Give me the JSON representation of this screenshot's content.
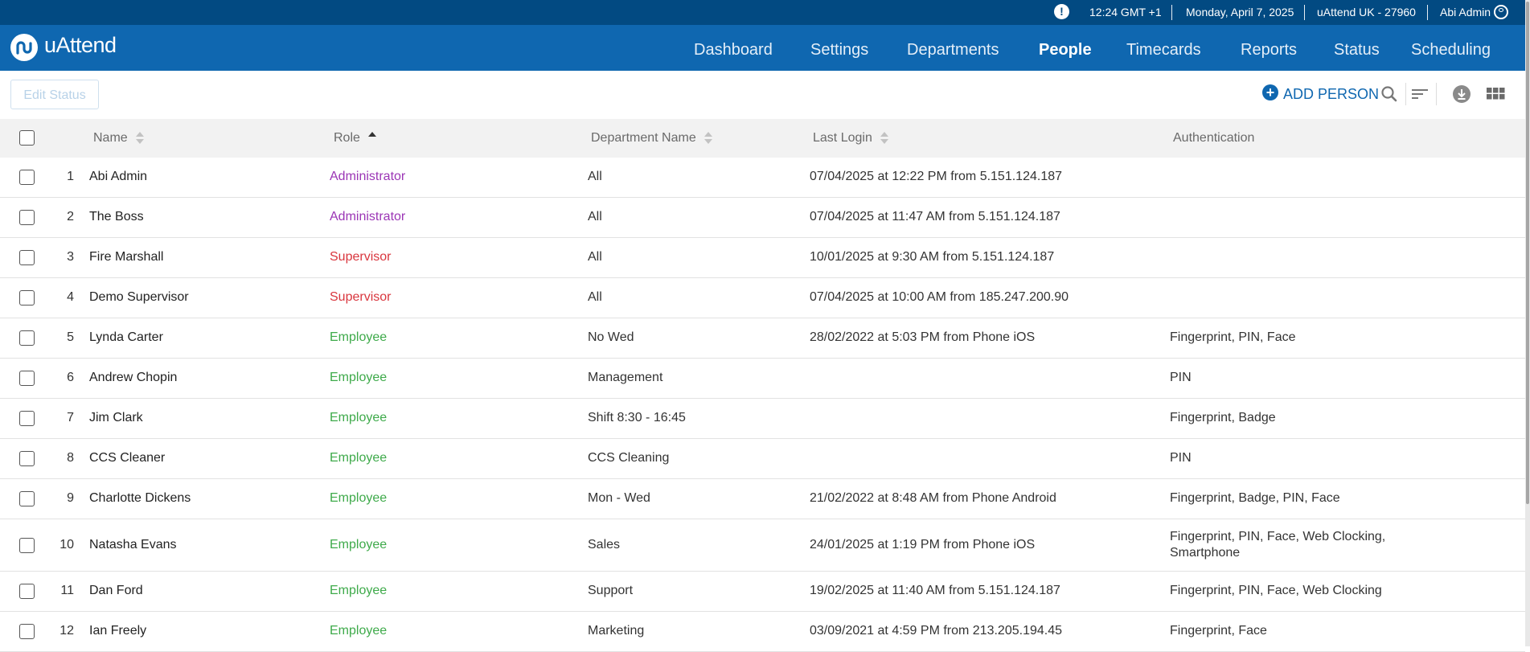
{
  "topbar": {
    "time": "12:24 GMT +1",
    "date": "Monday, April 7, 2025",
    "account": "uAttend UK - 27960",
    "user": "Abi Admin"
  },
  "brand": {
    "logo_text": "uAttend"
  },
  "nav": [
    {
      "label": "Dashboard"
    },
    {
      "label": "Settings"
    },
    {
      "label": "Departments"
    },
    {
      "label": "People",
      "active": true
    },
    {
      "label": "Timecards"
    },
    {
      "label": "Reports"
    },
    {
      "label": "Status"
    },
    {
      "label": "Scheduling"
    }
  ],
  "toolbar": {
    "edit_status": "Edit Status",
    "add_person": "ADD PERSON",
    "icons": [
      "search-icon",
      "sort-lines-icon",
      "download-icon",
      "grid-view-icon"
    ]
  },
  "table": {
    "columns": {
      "name": "Name",
      "role": "Role",
      "department": "Department Name",
      "last_login": "Last Login",
      "authentication": "Authentication"
    },
    "rows": [
      {
        "num": "1",
        "name": "Abi Admin",
        "role": "Administrator",
        "dept": "All",
        "login": "07/04/2025 at 12:22 PM from 5.151.124.187",
        "auth": ""
      },
      {
        "num": "2",
        "name": "The Boss",
        "role": "Administrator",
        "dept": "All",
        "login": "07/04/2025 at 11:47 AM from 5.151.124.187",
        "auth": ""
      },
      {
        "num": "3",
        "name": "Fire Marshall",
        "role": "Supervisor",
        "dept": "All",
        "login": "10/01/2025 at 9:30 AM from 5.151.124.187",
        "auth": ""
      },
      {
        "num": "4",
        "name": "Demo Supervisor",
        "role": "Supervisor",
        "dept": "All",
        "login": "07/04/2025 at 10:00 AM from 185.247.200.90",
        "auth": ""
      },
      {
        "num": "5",
        "name": "Lynda Carter",
        "role": "Employee",
        "dept": "No Wed",
        "login": "28/02/2022 at 5:03 PM from Phone iOS",
        "auth": "Fingerprint, PIN, Face"
      },
      {
        "num": "6",
        "name": "Andrew Chopin",
        "role": "Employee",
        "dept": "Management",
        "login": "",
        "auth": "PIN"
      },
      {
        "num": "7",
        "name": "Jim Clark",
        "role": "Employee",
        "dept": "Shift 8:30 - 16:45",
        "login": "",
        "auth": "Fingerprint, Badge"
      },
      {
        "num": "8",
        "name": "CCS Cleaner",
        "role": "Employee",
        "dept": "CCS Cleaning",
        "login": "",
        "auth": "PIN"
      },
      {
        "num": "9",
        "name": "Charlotte Dickens",
        "role": "Employee",
        "dept": "Mon - Wed",
        "login": "21/02/2022 at 8:48 AM from Phone Android",
        "auth": "Fingerprint, Badge, PIN, Face"
      },
      {
        "num": "10",
        "name": "Natasha Evans",
        "role": "Employee",
        "dept": "Sales",
        "login": "24/01/2025 at 1:19 PM from Phone iOS",
        "auth": "Fingerprint, PIN, Face, Web Clocking,",
        "auth2": "Smartphone"
      },
      {
        "num": "11",
        "name": "Dan Ford",
        "role": "Employee",
        "dept": "Support",
        "login": "19/02/2025 at 11:40 AM from 5.151.124.187",
        "auth": "Fingerprint, PIN, Face, Web Clocking"
      },
      {
        "num": "12",
        "name": "Ian Freely",
        "role": "Employee",
        "dept": "Marketing",
        "login": "03/09/2021 at 4:59 PM from 213.205.194.45",
        "auth": "Fingerprint, Face"
      }
    ]
  },
  "colors": {
    "topbar": "#024a82",
    "navbar": "#0f67b0",
    "administrator": "#9b35b5",
    "supervisor": "#d9363e",
    "employee": "#3eaa4a"
  }
}
